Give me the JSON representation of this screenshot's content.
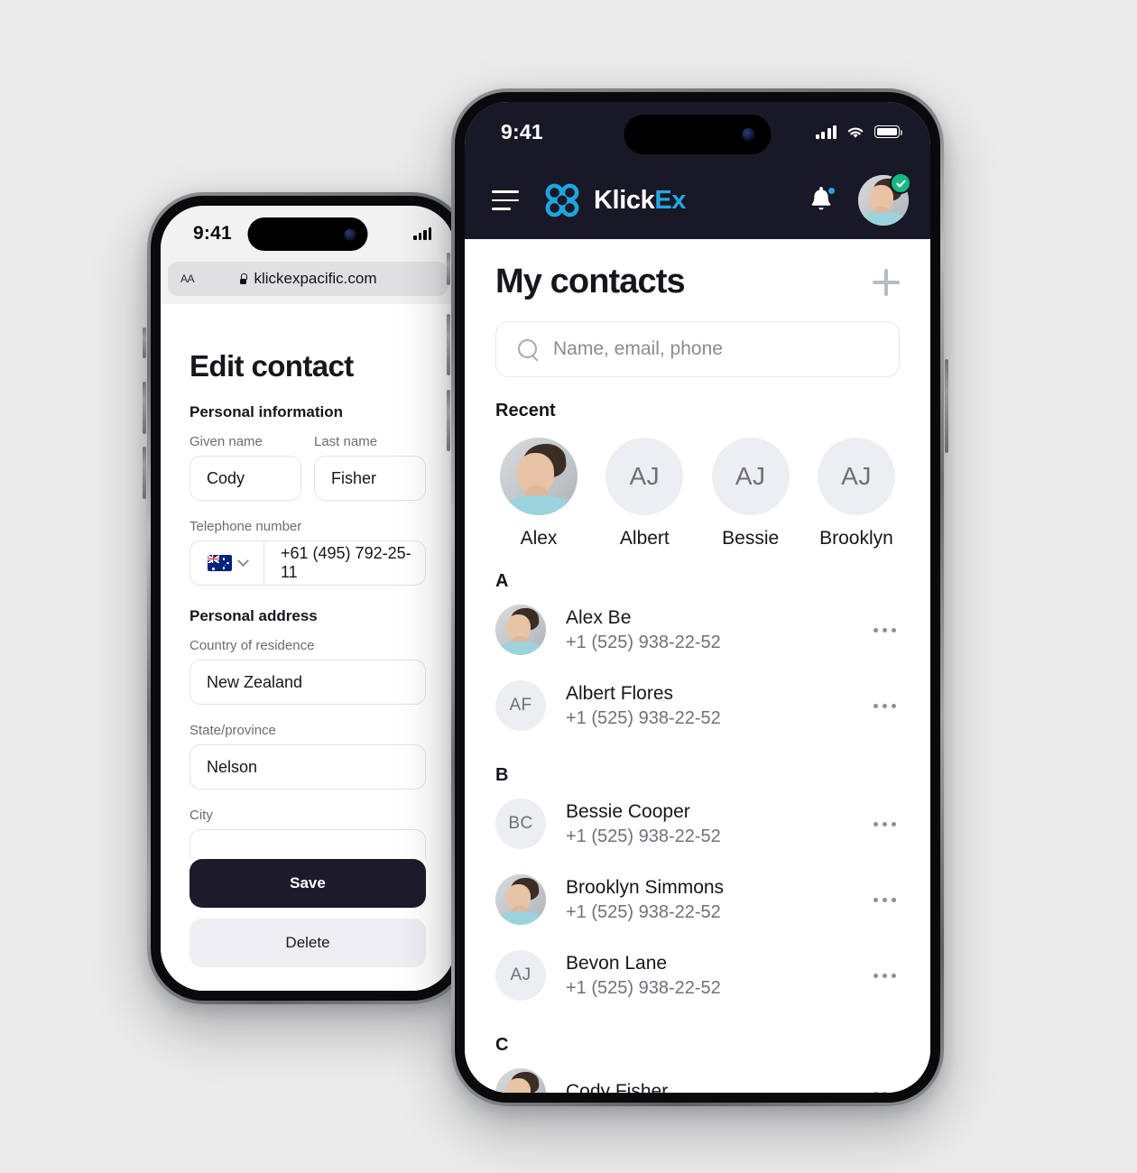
{
  "colors": {
    "page_background": "#ebebeb",
    "app_header": "#191826",
    "brand_accent": "#24a8e0",
    "verified_badge": "#13b981",
    "save_button": "#1d1b2b",
    "delete_button": "#eeeef3"
  },
  "left_phone": {
    "status_bar": {
      "time": "9:41"
    },
    "browser": {
      "text_size_control": "AA",
      "url": "klickexpacific.com",
      "lock_icon": "lock-icon"
    },
    "page": {
      "title": "Edit contact",
      "sections": [
        {
          "heading": "Personal information"
        },
        {
          "heading": "Personal address"
        }
      ],
      "fields": {
        "given_name_label": "Given name",
        "given_name_value": "Cody",
        "last_name_label": "Last name",
        "last_name_value": "Fisher",
        "telephone_label": "Telephone number",
        "telephone_value": "+61 (495) 792-25-11",
        "telephone_country_flag": "australia-flag-icon",
        "country_label": "Country of residence",
        "country_value": "New Zealand",
        "state_label": "State/province",
        "state_value": "Nelson",
        "city_label": "City"
      },
      "buttons": {
        "save": "Save",
        "delete": "Delete"
      }
    }
  },
  "right_phone": {
    "status_bar": {
      "time": "9:41",
      "signal_icon": "cellular-signal-icon",
      "wifi_icon": "wifi-icon",
      "battery_icon": "battery-icon"
    },
    "nav": {
      "menu_icon": "hamburger-menu-icon",
      "logo_icon": "klickex-logo-icon",
      "brand_primary": "Klick",
      "brand_accent": "Ex",
      "notifications_icon": "bell-icon",
      "notification_badge": true,
      "avatar_icon": "user-avatar",
      "verified_icon": "verified-check-icon"
    },
    "page": {
      "title": "My contacts",
      "add_button_icon": "plus-icon",
      "search": {
        "icon": "search-icon",
        "placeholder": "Name, email, phone",
        "value": ""
      },
      "recent_heading": "Recent",
      "recent": [
        {
          "name": "Alex",
          "initials": "",
          "has_photo": true
        },
        {
          "name": "Albert",
          "initials": "AJ",
          "has_photo": false
        },
        {
          "name": "Bessie",
          "initials": "AJ",
          "has_photo": false
        },
        {
          "name": "Brooklyn",
          "initials": "AJ",
          "has_photo": false
        }
      ],
      "groups": [
        {
          "letter": "A",
          "contacts": [
            {
              "name": "Alex Be",
              "phone": "+1 (525) 938-22-52",
              "initials": "",
              "has_photo": true
            },
            {
              "name": "Albert Flores",
              "phone": "+1 (525) 938-22-52",
              "initials": "AF",
              "has_photo": false
            }
          ]
        },
        {
          "letter": "B",
          "contacts": [
            {
              "name": "Bessie Cooper",
              "phone": "+1 (525) 938-22-52",
              "initials": "BC",
              "has_photo": false
            },
            {
              "name": "Brooklyn Simmons",
              "phone": "+1 (525) 938-22-52",
              "initials": "",
              "has_photo": true
            },
            {
              "name": "Bevon Lane",
              "phone": "+1 (525) 938-22-52",
              "initials": "AJ",
              "has_photo": false
            }
          ]
        },
        {
          "letter": "C",
          "contacts": [
            {
              "name": "Cody Fisher",
              "phone": "",
              "initials": "",
              "has_photo": true
            }
          ]
        }
      ],
      "row_menu_icon": "more-options-icon"
    }
  }
}
